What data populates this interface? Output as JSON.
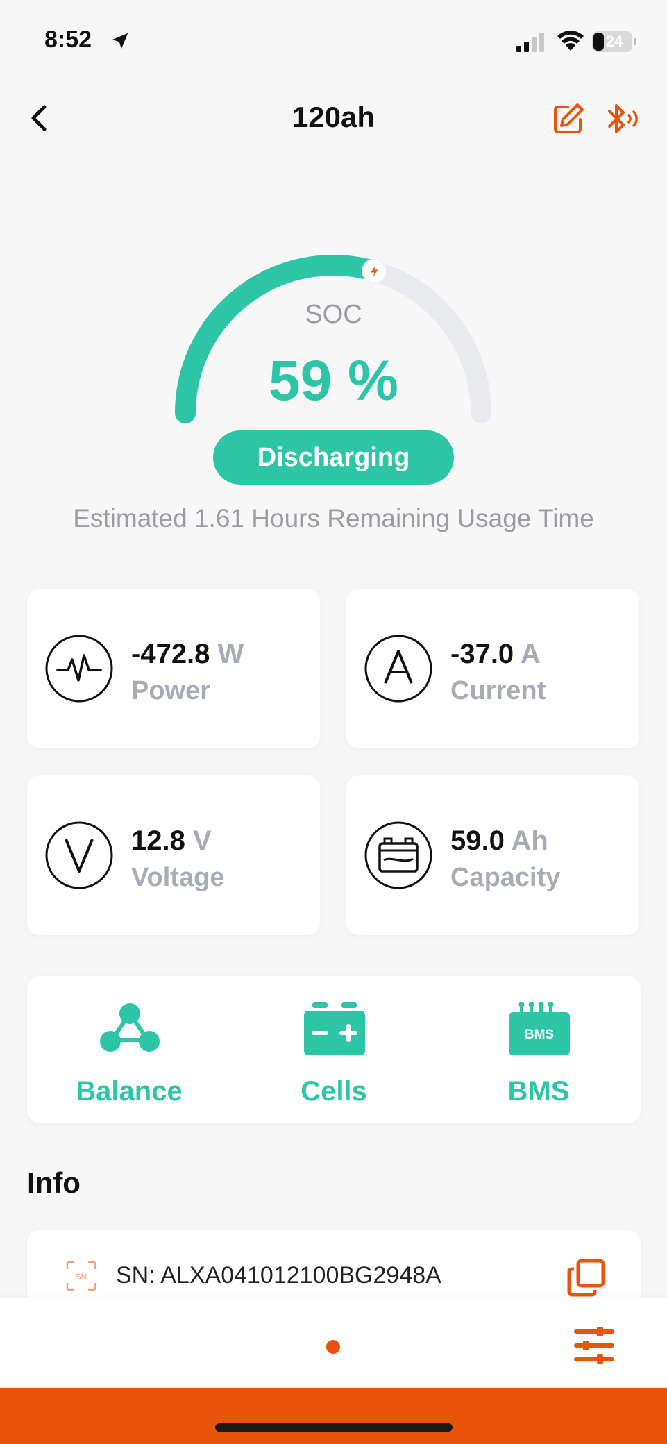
{
  "status_bar": {
    "time": "8:52",
    "battery_level": "24"
  },
  "nav": {
    "title": "120ah"
  },
  "gauge": {
    "label": "SOC",
    "value": "59 %",
    "soc_percent": 59,
    "status": "Discharging",
    "estimate": "Estimated 1.61 Hours Remaining Usage Time"
  },
  "metrics": [
    {
      "value": "-472.8",
      "unit": "W",
      "label": "Power",
      "icon": "pulse-icon"
    },
    {
      "value": "-37.0",
      "unit": "A",
      "label": "Current",
      "icon": "ampere-icon"
    },
    {
      "value": "12.8",
      "unit": "V",
      "label": "Voltage",
      "icon": "voltage-icon"
    },
    {
      "value": "59.0",
      "unit": "Ah",
      "label": "Capacity",
      "icon": "battery-icon"
    }
  ],
  "actions": [
    {
      "label": "Balance",
      "icon": "balance-icon"
    },
    {
      "label": "Cells",
      "icon": "cells-icon"
    },
    {
      "label": "BMS",
      "icon": "bms-icon",
      "icon_text": "BMS"
    }
  ],
  "info": {
    "title": "Info",
    "sn_icon_text": "SN",
    "sn": "SN: ALXA041012100BG2948A"
  },
  "colors": {
    "accent": "#2cc6a6",
    "brand": "#e8540a",
    "muted": "#a9abb5"
  }
}
